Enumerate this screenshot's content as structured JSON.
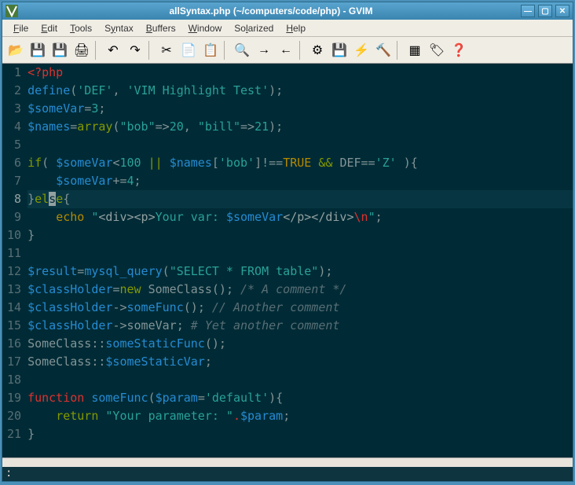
{
  "window": {
    "title": "allSyntax.php (~/computers/code/php) - GVIM"
  },
  "menu": {
    "items": [
      "File",
      "Edit",
      "Tools",
      "Syntax",
      "Buffers",
      "Window",
      "Solarized",
      "Help"
    ],
    "underlines": [
      0,
      0,
      0,
      1,
      0,
      0,
      2,
      0
    ]
  },
  "toolbar": {
    "icons": [
      "open",
      "save",
      "saveall",
      "print",
      "sep",
      "undo",
      "redo",
      "sep",
      "cut",
      "copy",
      "paste",
      "sep",
      "find",
      "next",
      "prev",
      "sep",
      "config",
      "savesess",
      "script",
      "make",
      "sep",
      "table",
      "tag",
      "help"
    ]
  },
  "code": {
    "lines": 21,
    "current_line": 8,
    "tokens": [
      [
        {
          "t": "<?php",
          "c": "red"
        }
      ],
      [
        {
          "t": "define",
          "c": "blue"
        },
        {
          "t": "(",
          "c": "base0"
        },
        {
          "t": "'DEF'",
          "c": "cyan"
        },
        {
          "t": ", ",
          "c": "base0"
        },
        {
          "t": "'VIM Highlight Test'",
          "c": "cyan"
        },
        {
          "t": ")",
          "c": "base0"
        },
        {
          "t": ";",
          "c": "base0"
        }
      ],
      [
        {
          "t": "$someVar",
          "c": "blue"
        },
        {
          "t": "=",
          "c": "base0"
        },
        {
          "t": "3",
          "c": "cyan"
        },
        {
          "t": ";",
          "c": "base0"
        }
      ],
      [
        {
          "t": "$names",
          "c": "blue"
        },
        {
          "t": "=",
          "c": "base0"
        },
        {
          "t": "array",
          "c": "green"
        },
        {
          "t": "(",
          "c": "base0"
        },
        {
          "t": "\"bob\"",
          "c": "cyan"
        },
        {
          "t": "=>",
          "c": "base0"
        },
        {
          "t": "20",
          "c": "cyan"
        },
        {
          "t": ", ",
          "c": "base0"
        },
        {
          "t": "\"bill\"",
          "c": "cyan"
        },
        {
          "t": "=>",
          "c": "base0"
        },
        {
          "t": "21",
          "c": "cyan"
        },
        {
          "t": ")",
          "c": "base0"
        },
        {
          "t": ";",
          "c": "base0"
        }
      ],
      [],
      [
        {
          "t": "if",
          "c": "green"
        },
        {
          "t": "( ",
          "c": "base0"
        },
        {
          "t": "$someVar",
          "c": "blue"
        },
        {
          "t": "<",
          "c": "base0"
        },
        {
          "t": "100",
          "c": "cyan"
        },
        {
          "t": " ",
          "c": "base0"
        },
        {
          "t": "||",
          "c": "green"
        },
        {
          "t": " ",
          "c": "base0"
        },
        {
          "t": "$names",
          "c": "blue"
        },
        {
          "t": "[",
          "c": "base0"
        },
        {
          "t": "'bob'",
          "c": "cyan"
        },
        {
          "t": "]",
          "c": "base0"
        },
        {
          "t": "!==",
          "c": "base0"
        },
        {
          "t": "TRUE",
          "c": "yellow"
        },
        {
          "t": " ",
          "c": "base0"
        },
        {
          "t": "&&",
          "c": "green"
        },
        {
          "t": " ",
          "c": "base0"
        },
        {
          "t": "DEF",
          "c": "base0"
        },
        {
          "t": "==",
          "c": "base0"
        },
        {
          "t": "'Z'",
          "c": "cyan"
        },
        {
          "t": " )",
          "c": "base0"
        },
        {
          "t": "{",
          "c": "base0"
        }
      ],
      [
        {
          "t": "    ",
          "c": "base0"
        },
        {
          "t": "$someVar",
          "c": "blue"
        },
        {
          "t": "+=",
          "c": "base0"
        },
        {
          "t": "4",
          "c": "cyan"
        },
        {
          "t": ";",
          "c": "base0"
        }
      ],
      [
        {
          "t": "}",
          "c": "base0"
        },
        {
          "t": "el",
          "c": "green"
        },
        {
          "t": "s",
          "c": "cursor"
        },
        {
          "t": "e",
          "c": "green"
        },
        {
          "t": "{",
          "c": "base0"
        }
      ],
      [
        {
          "t": "    ",
          "c": "base0"
        },
        {
          "t": "echo",
          "c": "yellow"
        },
        {
          "t": " ",
          "c": "base0"
        },
        {
          "t": "\"",
          "c": "cyan"
        },
        {
          "t": "<div><p>",
          "c": "base1"
        },
        {
          "t": "Your var: ",
          "c": "cyan"
        },
        {
          "t": "$someVar",
          "c": "blue"
        },
        {
          "t": "</p></div>",
          "c": "base1"
        },
        {
          "t": "\\n",
          "c": "red"
        },
        {
          "t": "\"",
          "c": "cyan"
        },
        {
          "t": ";",
          "c": "base0"
        }
      ],
      [
        {
          "t": "}",
          "c": "base0"
        }
      ],
      [],
      [
        {
          "t": "$result",
          "c": "blue"
        },
        {
          "t": "=",
          "c": "base0"
        },
        {
          "t": "mysql_query",
          "c": "blue"
        },
        {
          "t": "(",
          "c": "base0"
        },
        {
          "t": "\"SELECT * FROM table\"",
          "c": "cyan"
        },
        {
          "t": ")",
          "c": "base0"
        },
        {
          "t": ";",
          "c": "base0"
        }
      ],
      [
        {
          "t": "$classHolder",
          "c": "blue"
        },
        {
          "t": "=",
          "c": "base0"
        },
        {
          "t": "new",
          "c": "green"
        },
        {
          "t": " SomeClass()",
          "c": "base0"
        },
        {
          "t": ";",
          "c": "base0"
        },
        {
          "t": " ",
          "c": "base0"
        },
        {
          "t": "/* A comment */",
          "c": "base01 italic"
        }
      ],
      [
        {
          "t": "$classHolder",
          "c": "blue"
        },
        {
          "t": "->",
          "c": "base0"
        },
        {
          "t": "someFunc",
          "c": "blue"
        },
        {
          "t": "()",
          "c": "base0"
        },
        {
          "t": ";",
          "c": "base0"
        },
        {
          "t": " ",
          "c": "base0"
        },
        {
          "t": "// Another comment",
          "c": "base01 italic"
        }
      ],
      [
        {
          "t": "$classHolder",
          "c": "blue"
        },
        {
          "t": "->someVar",
          "c": "base0"
        },
        {
          "t": ";",
          "c": "base0"
        },
        {
          "t": " ",
          "c": "base0"
        },
        {
          "t": "# Yet another comment",
          "c": "base01 italic"
        }
      ],
      [
        {
          "t": "SomeClass",
          "c": "base0"
        },
        {
          "t": "::",
          "c": "base0"
        },
        {
          "t": "someStaticFunc",
          "c": "blue"
        },
        {
          "t": "()",
          "c": "base0"
        },
        {
          "t": ";",
          "c": "base0"
        }
      ],
      [
        {
          "t": "SomeClass",
          "c": "base0"
        },
        {
          "t": "::",
          "c": "base0"
        },
        {
          "t": "$someStaticVar",
          "c": "blue"
        },
        {
          "t": ";",
          "c": "base0"
        }
      ],
      [],
      [
        {
          "t": "function",
          "c": "red"
        },
        {
          "t": " ",
          "c": "base0"
        },
        {
          "t": "someFunc",
          "c": "blue"
        },
        {
          "t": "(",
          "c": "base0"
        },
        {
          "t": "$param",
          "c": "blue"
        },
        {
          "t": "=",
          "c": "base0"
        },
        {
          "t": "'default'",
          "c": "cyan"
        },
        {
          "t": ")",
          "c": "base0"
        },
        {
          "t": "{",
          "c": "base0"
        }
      ],
      [
        {
          "t": "    ",
          "c": "base0"
        },
        {
          "t": "return",
          "c": "green"
        },
        {
          "t": " ",
          "c": "base0"
        },
        {
          "t": "\"Your parameter: \"",
          "c": "cyan"
        },
        {
          "t": ".",
          "c": "red"
        },
        {
          "t": "$param",
          "c": "blue"
        },
        {
          "t": ";",
          "c": "base0"
        }
      ],
      [
        {
          "t": "}",
          "c": "base0"
        }
      ]
    ]
  },
  "status": {
    "text": ":"
  }
}
